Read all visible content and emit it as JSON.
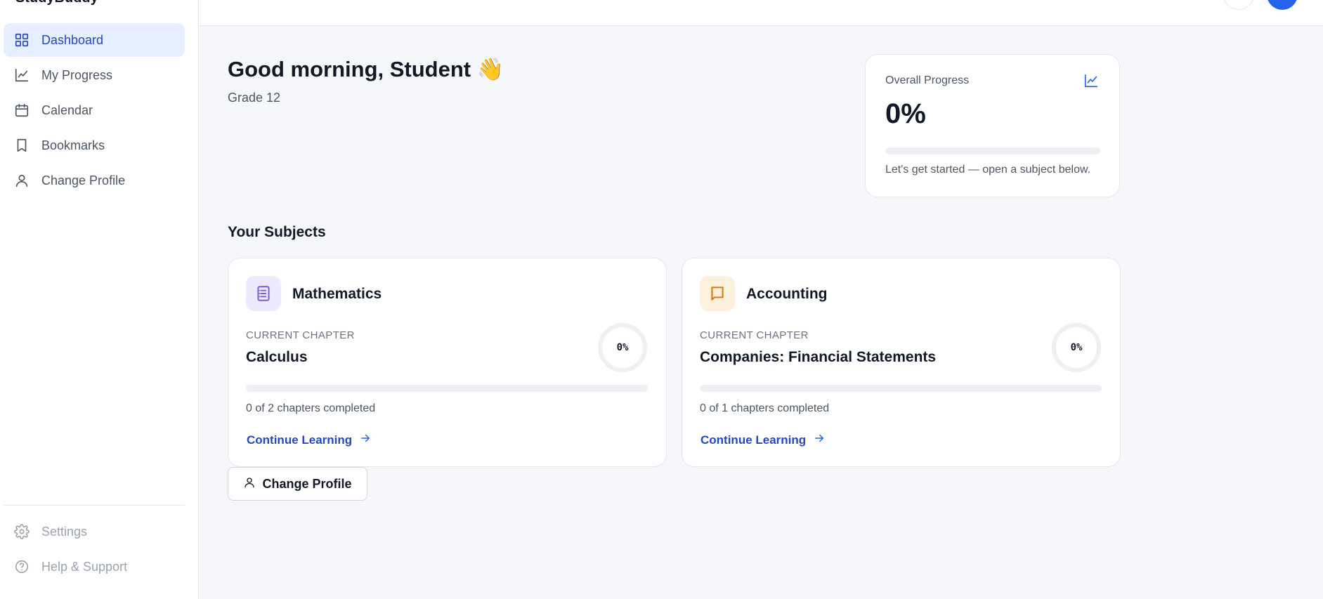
{
  "sidebar": {
    "brand": "StudyBuddy",
    "items": [
      {
        "label": "Dashboard",
        "icon": "grid-icon",
        "active": true
      },
      {
        "label": "My Progress",
        "icon": "chart-line-icon",
        "active": false
      },
      {
        "label": "Calendar",
        "icon": "calendar-icon",
        "active": false
      },
      {
        "label": "Bookmarks",
        "icon": "bookmark-icon",
        "active": false
      },
      {
        "label": "Change Profile",
        "icon": "user-icon",
        "active": false
      }
    ],
    "bottom_items": [
      {
        "label": "Settings",
        "icon": "gear-icon"
      },
      {
        "label": "Help & Support",
        "icon": "help-circle-icon"
      }
    ]
  },
  "header": {
    "greeting": "Good morning, Student 👋",
    "grade": "Grade 12"
  },
  "overall_progress": {
    "label": "Overall Progress",
    "percent_text": "0%",
    "fraction": 0,
    "hint": "Let's get started — open a subject below.",
    "icon": "chart-line-icon"
  },
  "subjects_section": {
    "title": "Your Subjects",
    "subjects": [
      {
        "name": "Mathematics",
        "icon": "notebook-icon",
        "icon_color": "#7c5cd6",
        "icon_bg": "#ede9fe",
        "current_chapter_label": "CURRENT CHAPTER",
        "current_chapter": "Calculus",
        "progress_text": "0%",
        "fraction": 0,
        "completed_text": "0 of 2 chapters completed",
        "cta": "Continue Learning"
      },
      {
        "name": "Accounting",
        "icon": "book-icon",
        "icon_color": "#d97706",
        "icon_bg": "#fdf0dc",
        "current_chapter_label": "CURRENT CHAPTER",
        "current_chapter": "Companies: Financial Statements",
        "progress_text": "0%",
        "fraction": 0,
        "completed_text": "0 of 1 chapters completed",
        "cta": "Continue Learning"
      }
    ]
  },
  "change_profile_button": {
    "label": "Change Profile",
    "icon": "user-icon"
  },
  "colors": {
    "accent": "#2563eb",
    "active_bg": "#e6efff",
    "page_bg": "#f6f7fa"
  }
}
